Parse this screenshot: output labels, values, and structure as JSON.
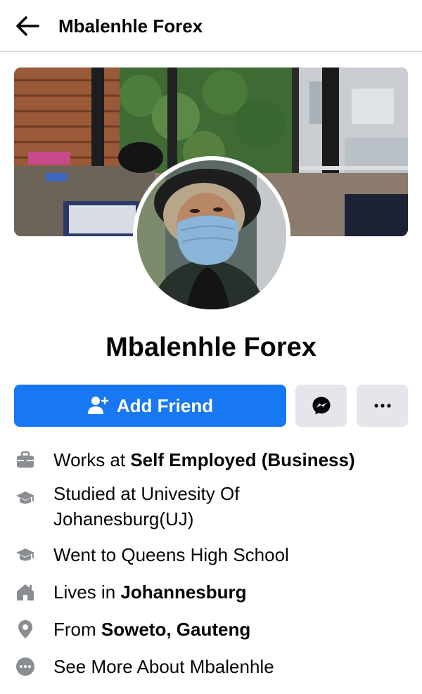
{
  "header": {
    "title": "Mbalenhle Forex",
    "back_icon": "arrow-left-icon"
  },
  "profile": {
    "name": "Mbalenhle Forex"
  },
  "actions": {
    "add_friend_label": "Add Friend",
    "add_friend_icon": "person-plus-icon",
    "messenger_icon": "messenger-icon",
    "more_icon": "ellipsis-icon"
  },
  "colors": {
    "primary": "#1877f2",
    "secondary_button": "#e4e6eb",
    "icon_gray": "#8a8d91",
    "text": "#050505"
  },
  "about": {
    "work": {
      "prefix": "Works at ",
      "value": "Self Employed (Business)",
      "icon": "briefcase-icon"
    },
    "study": {
      "line1": "Studied at Univesity Of",
      "line2": "Johanesburg(UJ)",
      "icon": "graduation-cap-icon"
    },
    "school": {
      "text": "Went to Queens High School",
      "icon": "graduation-cap-icon"
    },
    "lives": {
      "prefix": "Lives in ",
      "value": "Johannesburg",
      "icon": "house-icon"
    },
    "from": {
      "prefix": "From ",
      "value": "Soweto, Gauteng",
      "icon": "map-pin-icon"
    },
    "see_more": {
      "text": "See More About Mbalenhle",
      "icon": "ellipsis-circle-icon"
    }
  }
}
